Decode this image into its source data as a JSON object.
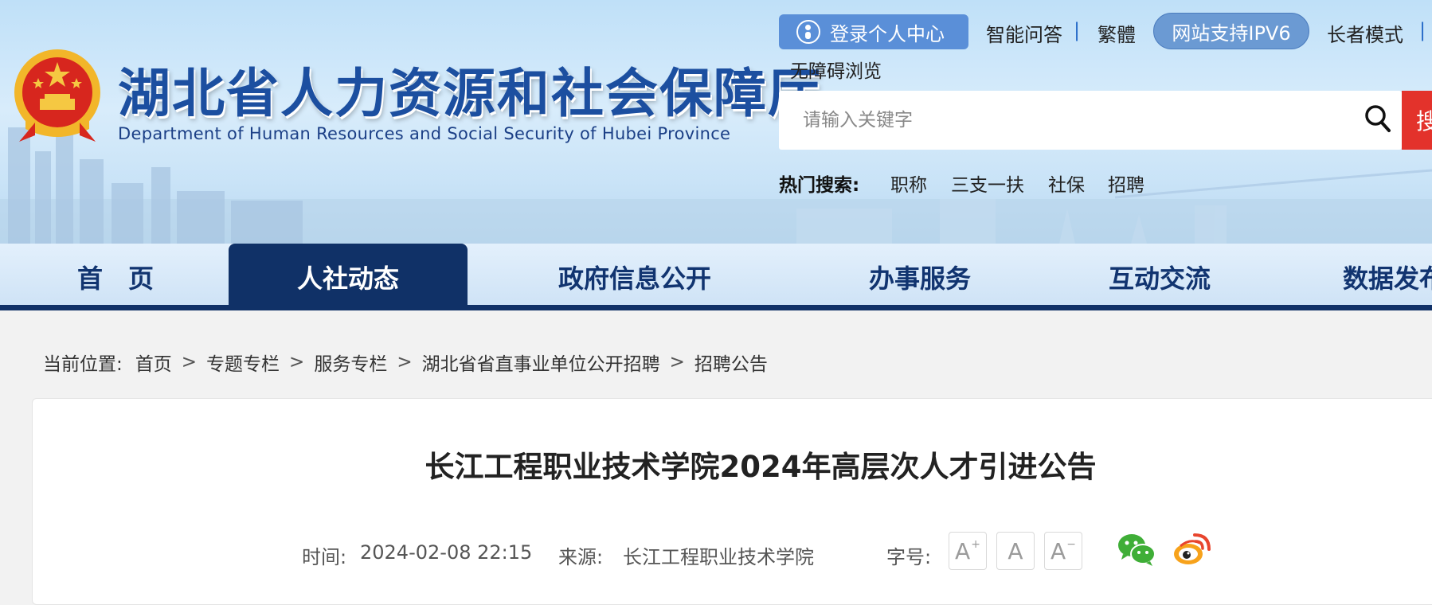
{
  "header": {
    "site_title": "湖北省人力资源和社会保障厅",
    "site_subtitle": "Department of Human Resources and Social Security of Hubei Province",
    "login_label": "登录个人中心",
    "links": {
      "ai_qa": "智能问答",
      "traditional": "繁體",
      "ipv6": "网站支持IPV6",
      "elder_mode": "长者模式",
      "accessibility": "无障碍浏览"
    },
    "separator": "|"
  },
  "search": {
    "placeholder": "请输入关键字",
    "button_label": "搜",
    "hot_label": "热门搜索:",
    "hot_words": [
      "职称",
      "三支一扶",
      "社保",
      "招聘"
    ]
  },
  "nav": {
    "items": [
      "首　页",
      "人社动态",
      "政府信息公开",
      "办事服务",
      "互动交流",
      "数据发布"
    ],
    "active_index": 1
  },
  "breadcrumb": {
    "label": "当前位置:",
    "items": [
      "首页",
      "专题专栏",
      "服务专栏",
      "湖北省省直事业单位公开招聘",
      "招聘公告"
    ],
    "separator": ">"
  },
  "article": {
    "title": "长江工程职业技术学院2024年高层次人才引进公告",
    "time_label": "时间:",
    "time": "2024-02-08 22:15",
    "source_label": "来源:",
    "source": "长江工程职业技术学院",
    "font_size_label": "字号:",
    "font_buttons": [
      "A",
      "A",
      "A"
    ]
  },
  "colors": {
    "nav_active": "#103167",
    "title_blue": "#1c4fa0",
    "search_red": "#e3322b",
    "login_blue": "#5a8fd8"
  },
  "icons": [
    "national-emblem-icon",
    "user-icon",
    "search-icon",
    "wechat-icon",
    "weibo-icon"
  ]
}
